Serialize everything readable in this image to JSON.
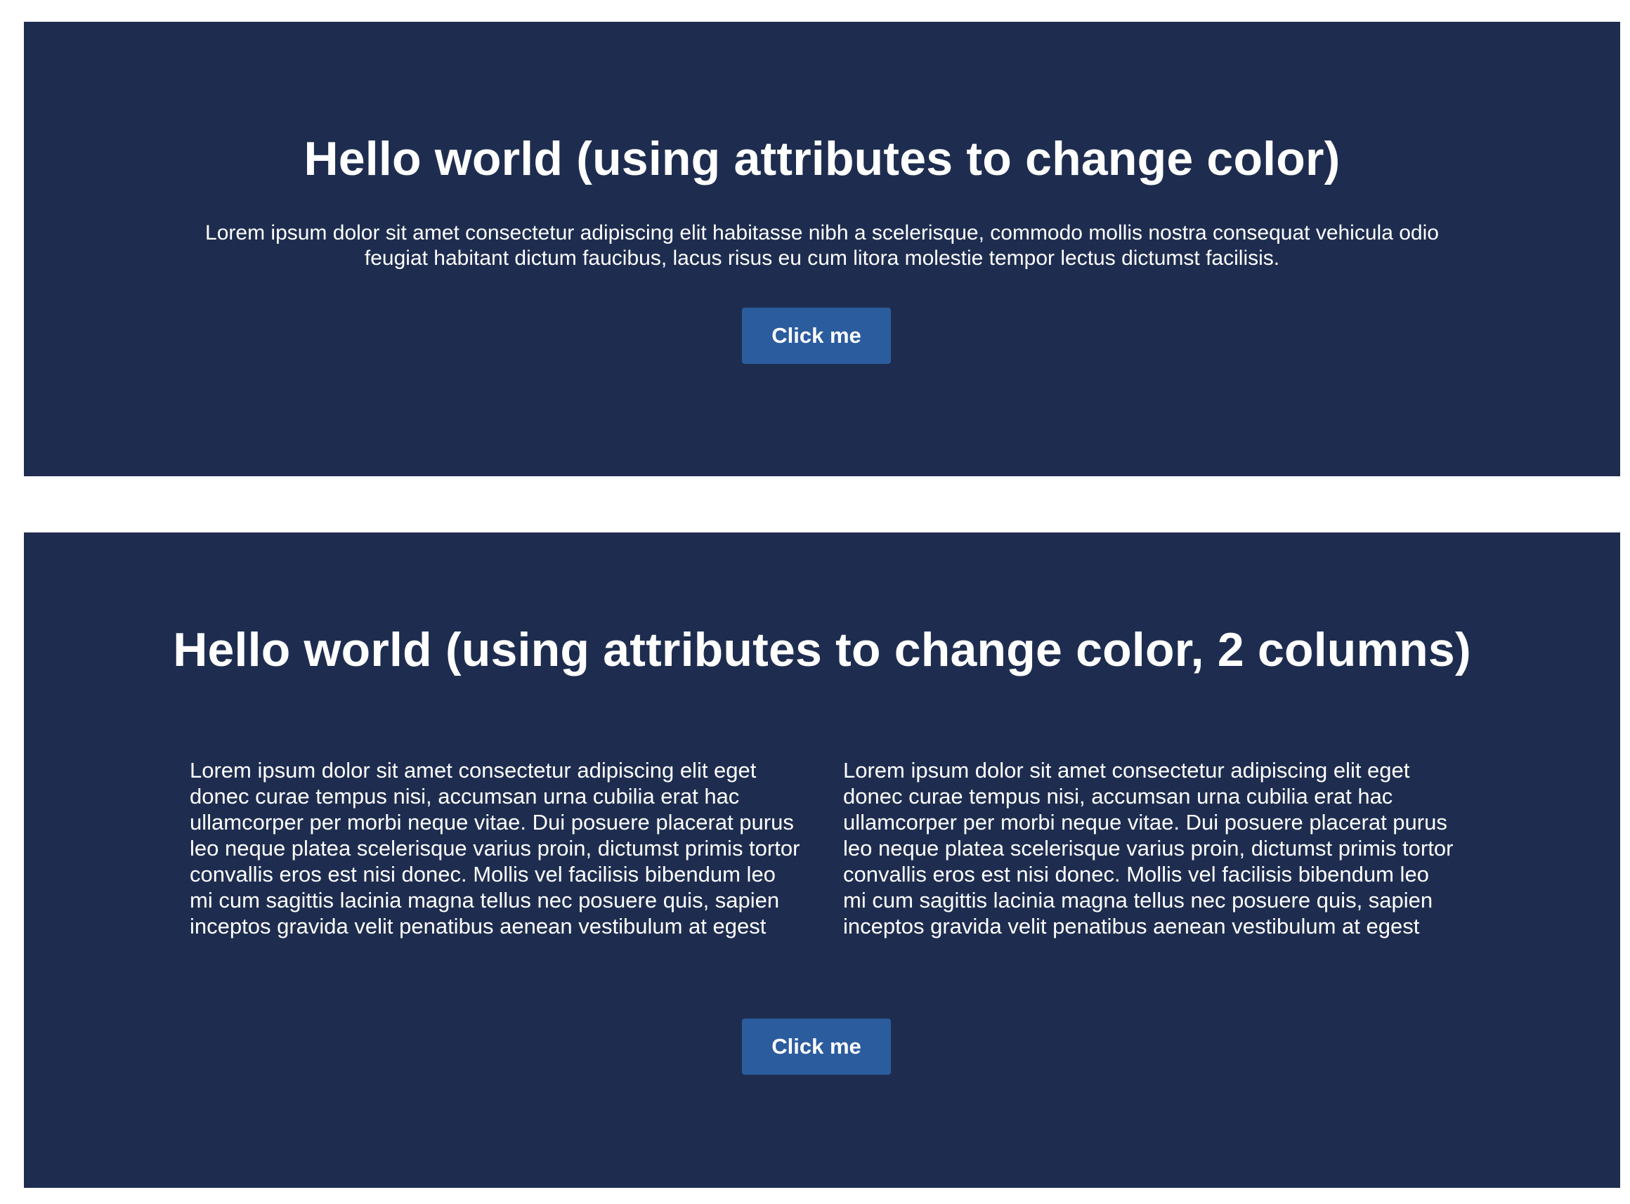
{
  "panels": [
    {
      "title": "Hello world (using attributes to change color)",
      "paragraph": "Lorem ipsum dolor sit amet consectetur adipiscing elit habitasse nibh a scelerisque, commodo mollis nostra consequat vehicula odio feugiat habitant dictum faucibus, lacus risus eu cum litora molestie tempor lectus dictumst facilisis.",
      "button_label": "Click me"
    },
    {
      "title": "Hello world (using attributes to change color, 2 columns)",
      "columns": [
        "Lorem ipsum dolor sit amet consectetur adipiscing elit eget donec curae tempus nisi, accumsan urna cubilia erat hac ullamcorper per morbi neque vitae. Dui posuere placerat purus leo neque platea scelerisque varius proin, dictumst primis tortor convallis eros est nisi donec. Mollis vel facilisis bibendum leo mi cum sagittis lacinia magna tellus nec posuere quis, sapien inceptos gravida velit penatibus aenean vestibulum at egest",
        "Lorem ipsum dolor sit amet consectetur adipiscing elit eget donec curae tempus nisi, accumsan urna cubilia erat hac ullamcorper per morbi neque vitae. Dui posuere placerat purus leo neque platea scelerisque varius proin, dictumst primis tortor convallis eros est nisi donec. Mollis vel facilisis bibendum leo mi cum sagittis lacinia magna tellus nec posuere quis, sapien inceptos gravida velit penatibus aenean vestibulum at egest"
      ],
      "button_label": "Click me"
    }
  ],
  "colors": {
    "panel_background": "#1e2d4f",
    "button_background": "#2b5c9e",
    "text": "#ffffff",
    "page_background": "#ffffff"
  }
}
